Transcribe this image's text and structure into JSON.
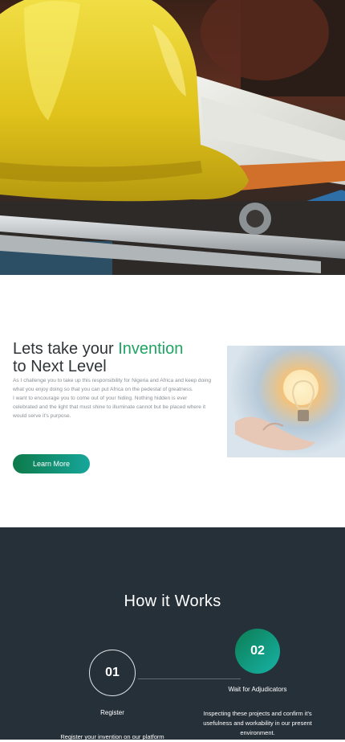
{
  "about": {
    "title_part1": "Lets take your ",
    "title_accent": "Invention",
    "title_part2": "to Next Level",
    "paragraph1": "As I challenge you to take up this responsibility for Nigeria and Africa and keep doing what you enjoy doing so that you can put Africa on the pedestal of greatness.",
    "paragraph2": "I want to encourage you to come out of your hiding. Nothing hidden is ever celebrated and the light that must shine to illuminate cannot but be placed where it would serve it's purpose.",
    "button_label": "Learn More",
    "accent_color": "#1fa463"
  },
  "how_it_works": {
    "title": "How it Works",
    "steps": [
      {
        "number": "01",
        "label": "Register",
        "description": "Register your invention on our platform"
      },
      {
        "number": "02",
        "label": "Wait for Adjudicators",
        "description": "Inspecting these projects and confirm it's usefulness and workability in our present environment."
      }
    ]
  },
  "colors": {
    "dark_section": "#263039",
    "button_gradient_start": "#0d7a4a",
    "button_gradient_end": "#17a69b"
  }
}
